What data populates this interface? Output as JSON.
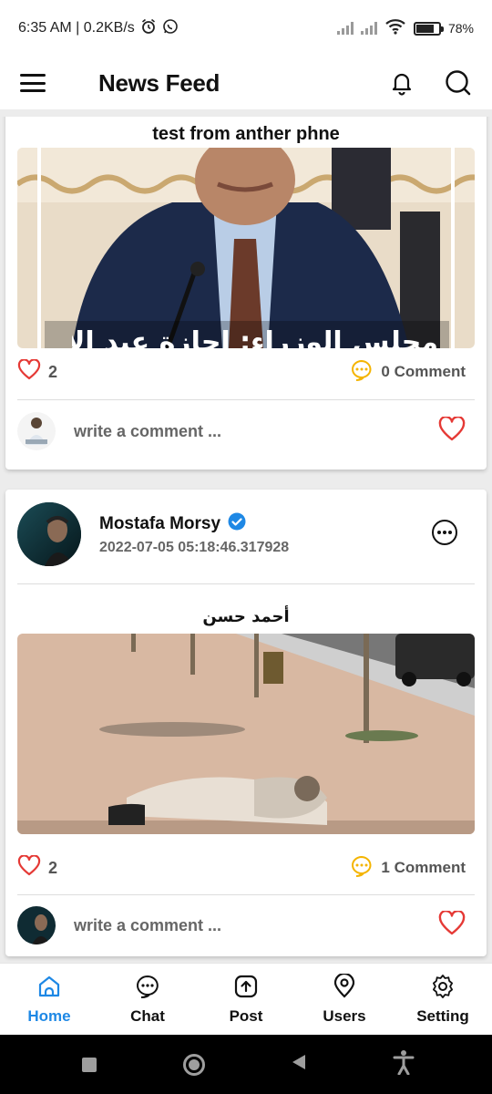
{
  "status_bar": {
    "time_speed": "6:35 AM | 0.2KB/s",
    "battery": "78%",
    "battery_level": 0.78
  },
  "app_bar": {
    "title": "News Feed",
    "icons": [
      "menu-icon",
      "bell-icon",
      "search-icon"
    ]
  },
  "posts": [
    {
      "caption": "test from anther phne",
      "image_text": "مجلس الوزراء: إجازة عيد الأضحى",
      "likes": "2",
      "comments": "0 Comment",
      "write_placeholder": "write a comment ..."
    },
    {
      "author": "Mostafa Morsy",
      "verified": true,
      "timestamp": "2022-07-05 05:18:46.317928",
      "caption": "أحمد حسن",
      "likes": "2",
      "comments": "1 Comment",
      "write_placeholder": "write a comment ..."
    }
  ],
  "bottom_nav": [
    {
      "label": "Home",
      "icon": "home-icon",
      "active": true
    },
    {
      "label": "Chat",
      "icon": "chat-icon",
      "active": false
    },
    {
      "label": "Post",
      "icon": "upload-icon",
      "active": false
    },
    {
      "label": "Users",
      "icon": "location-pin-icon",
      "active": false
    },
    {
      "label": "Setting",
      "icon": "gear-icon",
      "active": false
    }
  ],
  "colors": {
    "accent": "#1e88e5",
    "heart": "#e53935",
    "comment_icon": "#f4b400",
    "verified": "#1e88e5"
  }
}
